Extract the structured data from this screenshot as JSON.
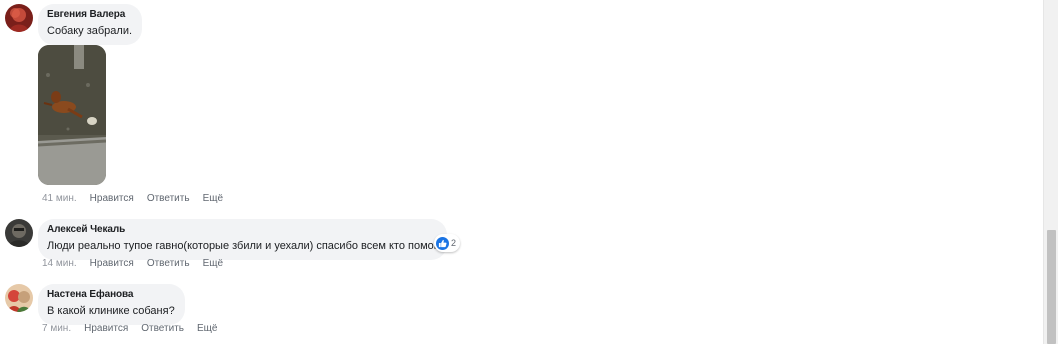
{
  "comments": [
    {
      "author": "Евгения Валера",
      "text": "Собаку забрали.",
      "time": "41 мин.",
      "like": "Нравится",
      "reply": "Ответить",
      "more": "Ещё",
      "has_photo": true
    },
    {
      "author": "Алексей Чекаль",
      "text": "Люди реально тупое гавно(которые збили и уехали) спасибо всем кто помог",
      "time": "14 мин.",
      "like": "Нравится",
      "reply": "Ответить",
      "more": "Ещё",
      "reactions": {
        "icon": "like-icon",
        "count": "2"
      }
    },
    {
      "author": "Настена Ефанова",
      "text": "В какой клинике собаня?",
      "time": "7 мин.",
      "like": "Нравится",
      "reply": "Ответить",
      "more": "Ещё"
    }
  ],
  "colors": {
    "bubble": "#f2f3f5",
    "action_text": "#606770",
    "reaction_blue": "#1b74e4"
  }
}
